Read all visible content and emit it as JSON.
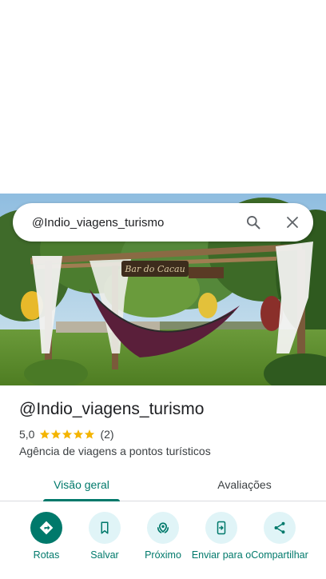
{
  "search": {
    "query": "@Indio_viagens_turismo"
  },
  "photo": {
    "sign_text": "Bar do Cacau"
  },
  "place": {
    "title": "@Indio_viagens_turismo",
    "rating": "5,0",
    "review_count": "(2)",
    "stars_filled": 5,
    "category": "Agência de viagens a pontos turísticos"
  },
  "tabs": [
    {
      "label": "Visão geral",
      "active": true
    },
    {
      "label": "Avaliações",
      "active": false
    }
  ],
  "actions": [
    {
      "label": "Rotas",
      "icon": "directions-icon"
    },
    {
      "label": "Salvar",
      "icon": "bookmark-icon"
    },
    {
      "label": "Próximo",
      "icon": "nearby-icon"
    },
    {
      "label": "Enviar para o",
      "icon": "send-to-phone-icon"
    },
    {
      "label": "Compartilhar",
      "icon": "share-icon"
    }
  ],
  "colors": {
    "accent": "#00796b",
    "action_bg": "#e0f4f7",
    "star": "#f4b400"
  }
}
